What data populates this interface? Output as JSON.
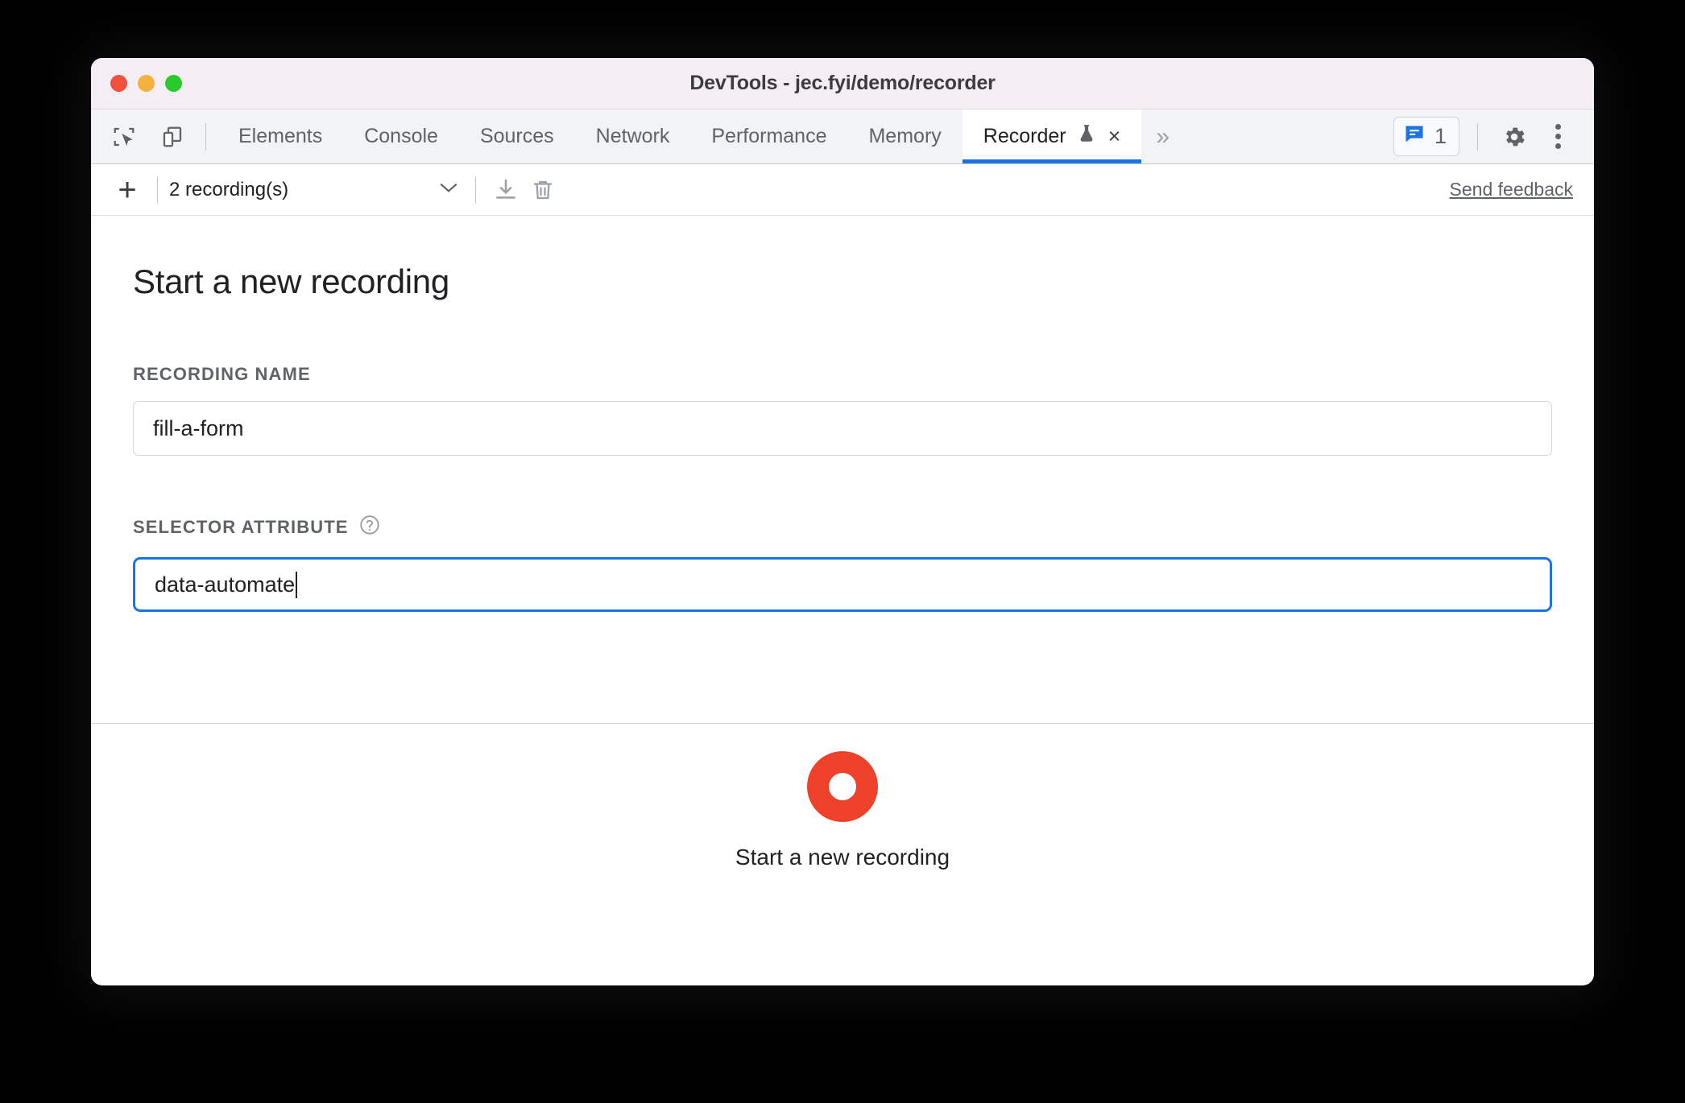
{
  "window": {
    "title": "DevTools - jec.fyi/demo/recorder",
    "traffic_lights": [
      "close",
      "minimize",
      "maximize"
    ]
  },
  "tabstrip": {
    "left_icons": [
      {
        "name": "inspect-element-icon",
        "label": "Inspect element"
      },
      {
        "name": "device-toolbar-icon",
        "label": "Toggle device toolbar"
      }
    ],
    "tabs": [
      {
        "label": "Elements",
        "active": false
      },
      {
        "label": "Console",
        "active": false
      },
      {
        "label": "Sources",
        "active": false
      },
      {
        "label": "Network",
        "active": false
      },
      {
        "label": "Performance",
        "active": false
      },
      {
        "label": "Memory",
        "active": false
      },
      {
        "label": "Recorder",
        "active": true,
        "experimental": true,
        "closable": true
      }
    ],
    "close_glyph": "×",
    "overflow_glyph": "»",
    "issues": {
      "count": "1",
      "icon": "issues-message-icon",
      "color": "#1a73e8"
    },
    "settings_icon": "gear-icon",
    "more_icon": "kebab-menu-icon"
  },
  "recorder_toolbar": {
    "add_glyph": "+",
    "recordings_label": "2 recording(s)",
    "dropdown_glyph": "∨",
    "import_icon": "download-import-icon",
    "delete_icon": "trash-icon",
    "feedback_label": "Send feedback"
  },
  "main": {
    "title": "Start a new recording",
    "recording_name": {
      "label": "RECORDING NAME",
      "value": "fill-a-form",
      "placeholder": "Recording name",
      "focused": false
    },
    "selector_attribute": {
      "label": "SELECTOR ATTRIBUTE",
      "help_icon": "help-question-icon",
      "value": "data-automate",
      "placeholder": "Selector attribute",
      "focused": true
    }
  },
  "footer": {
    "record_button_label": "Start a new recording",
    "record_button_color": "#ee4129"
  }
}
